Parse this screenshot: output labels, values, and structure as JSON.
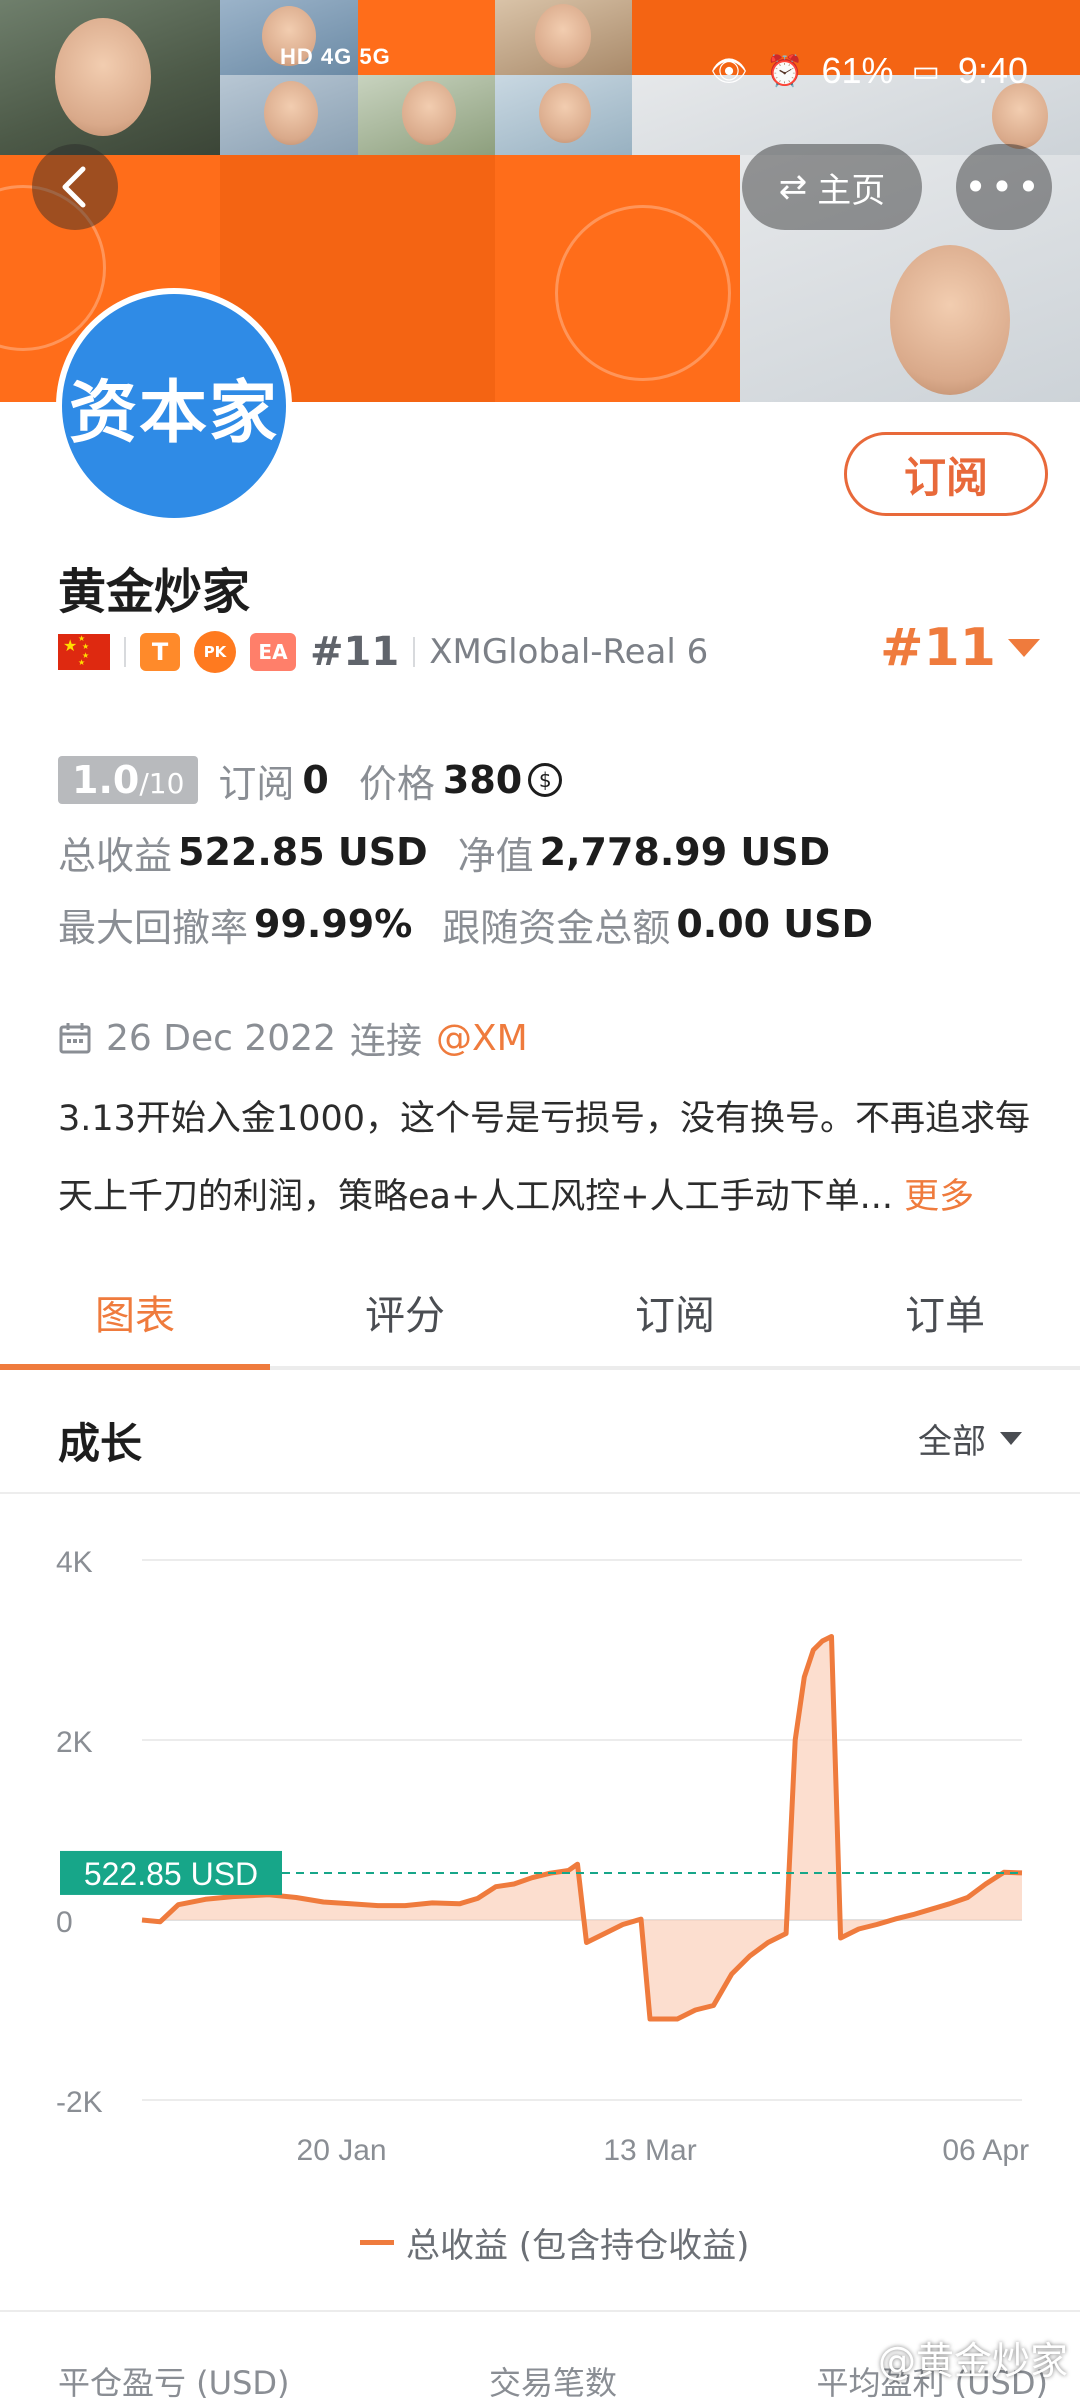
{
  "status_bar": {
    "left_text": "HD 4G 5G",
    "battery": "61%",
    "time": "9:40"
  },
  "nav": {
    "home_label": "主页",
    "more_label": "•••"
  },
  "profile": {
    "avatar_text": "资本家",
    "name": "黄金炒家",
    "subscribe_label": "订阅",
    "badge_t": "T",
    "badge_pk": "PK",
    "badge_ea": "EA",
    "rank_small": "#11",
    "server": "XMGlobal-Real 6",
    "rank_big": "#11"
  },
  "stats": {
    "score": "1.0",
    "score_max": "/10",
    "subscribe_label": "订阅",
    "subscribe_count": "0",
    "price_label": "价格",
    "price_value": "380",
    "total_profit_label": "总收益",
    "total_profit_value": "522.85 USD",
    "equity_label": "净值",
    "equity_value": "2,778.99 USD",
    "max_drawdown_label": "最大回撤率",
    "max_drawdown_value": "99.99%",
    "follow_funds_label": "跟随资金总额",
    "follow_funds_value": "0.00 USD"
  },
  "connection": {
    "date": "26 Dec 2022",
    "label": "连接",
    "broker": "@XM"
  },
  "description": {
    "text": "3.13开始入金1000，这个号是亏损号，没有换号。不再追求每天上千刀的利润，策略ea+人工风控+人工手动下单...",
    "more": "更多"
  },
  "tabs": [
    "图表",
    "评分",
    "订阅",
    "订单"
  ],
  "growth": {
    "title": "成长",
    "filter": "全部"
  },
  "chart_data": {
    "type": "area",
    "title": "",
    "ylabel": "",
    "xlabel": "",
    "yticks": [
      "4K",
      "2K",
      "0",
      "-2K"
    ],
    "ylim": [
      -2000,
      4000
    ],
    "xticks": [
      "20 Jan",
      "13 Mar",
      "06 Apr"
    ],
    "current_label": "522.85 USD",
    "current_value": 522.85,
    "series": [
      {
        "name": "总收益 (包含持仓收益)",
        "points": [
          [
            0,
            0
          ],
          [
            2,
            -20
          ],
          [
            4,
            170
          ],
          [
            7,
            230
          ],
          [
            10,
            260
          ],
          [
            14,
            280
          ],
          [
            17,
            250
          ],
          [
            20,
            200
          ],
          [
            23,
            180
          ],
          [
            26,
            160
          ],
          [
            29,
            160
          ],
          [
            32,
            190
          ],
          [
            35,
            180
          ],
          [
            37,
            240
          ],
          [
            39,
            370
          ],
          [
            41,
            400
          ],
          [
            43,
            470
          ],
          [
            45,
            520
          ],
          [
            47,
            550
          ],
          [
            48,
            620
          ],
          [
            49,
            -250
          ],
          [
            51,
            -150
          ],
          [
            53,
            -50
          ],
          [
            55,
            10
          ],
          [
            56,
            -1100
          ],
          [
            59,
            -1100
          ],
          [
            61,
            -1000
          ],
          [
            63,
            -950
          ],
          [
            65,
            -600
          ],
          [
            67,
            -400
          ],
          [
            69,
            -250
          ],
          [
            71,
            -150
          ],
          [
            72,
            2000
          ],
          [
            73,
            2700
          ],
          [
            74,
            3000
          ],
          [
            75,
            3100
          ],
          [
            76,
            3150
          ],
          [
            77,
            -200
          ],
          [
            79,
            -100
          ],
          [
            81,
            -50
          ],
          [
            83,
            10
          ],
          [
            85,
            60
          ],
          [
            87,
            120
          ],
          [
            89,
            180
          ],
          [
            91,
            250
          ],
          [
            93,
            400
          ],
          [
            95,
            530
          ],
          [
            97,
            522.85
          ]
        ]
      }
    ],
    "legend": "总收益 (包含持仓收益)",
    "colors": {
      "line": "#ef7b3d",
      "area": "#fbd3bf",
      "marker": "#17a689",
      "grid": "#ececec"
    }
  },
  "bottom_stats": {
    "labels": [
      "平仓盈亏 (USD)",
      "交易笔数",
      "平均盈利 (USD)"
    ]
  },
  "watermark": "@黄金炒家"
}
